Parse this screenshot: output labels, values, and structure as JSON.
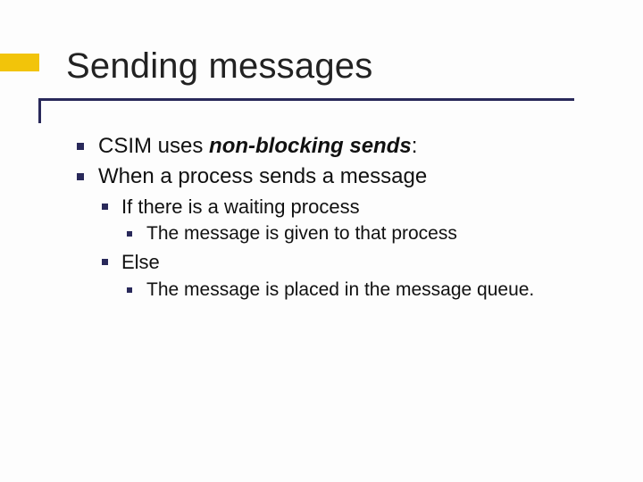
{
  "title": "Sending messages",
  "bullets": {
    "item1_pre": "CSIM uses ",
    "item1_em": "non-blocking sends",
    "item1_post": ":",
    "item2": "When a process sends a message",
    "item2a": "If there is a waiting process",
    "item2a1": "The message is given to that process",
    "item2b": "Else",
    "item2b1": "The message is placed in the message queue."
  }
}
